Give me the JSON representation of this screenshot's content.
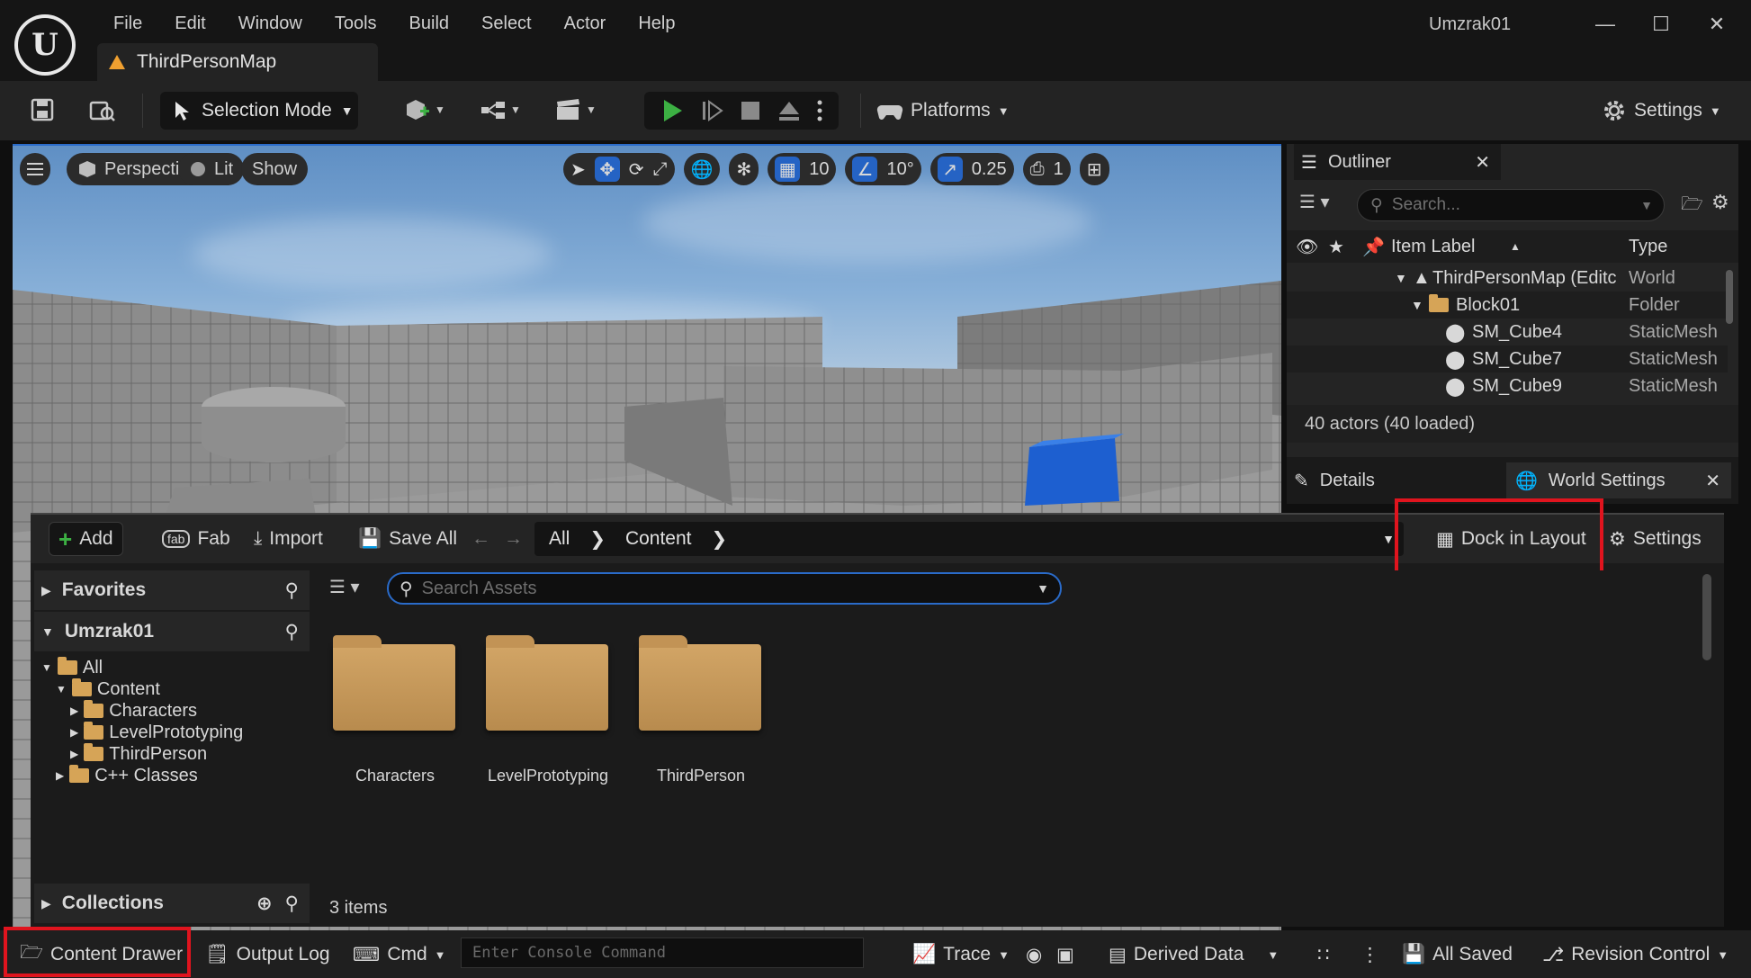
{
  "app": {
    "project_name": "Umzrak01",
    "menu": [
      "File",
      "Edit",
      "Window",
      "Tools",
      "Build",
      "Select",
      "Actor",
      "Help"
    ],
    "map_tab": "ThirdPersonMap"
  },
  "toolbar": {
    "selection_mode": "Selection Mode",
    "platforms": "Platforms",
    "settings": "Settings"
  },
  "viewport": {
    "perspective": "Perspective",
    "lit": "Lit",
    "show": "Show",
    "grid_snap": "10",
    "rotation_snap": "10°",
    "scale_snap": "0.25",
    "camera_speed": "1"
  },
  "outliner": {
    "tab": "Outliner",
    "search_placeholder": "Search...",
    "col_label": "Item Label",
    "col_type": "Type",
    "rows": [
      {
        "label": "ThirdPersonMap (Editc",
        "type": "World"
      },
      {
        "label": "Block01",
        "type": "Folder"
      },
      {
        "label": "SM_Cube4",
        "type": "StaticMesh"
      },
      {
        "label": "SM_Cube7",
        "type": "StaticMesh"
      },
      {
        "label": "SM_Cube9",
        "type": "StaticMesh"
      }
    ],
    "footer": "40 actors (40 loaded)"
  },
  "details": {
    "tab": "Details",
    "world_settings": "World Settings"
  },
  "drawer": {
    "add": "Add",
    "fab": "Fab",
    "import": "Import",
    "save_all": "Save All",
    "path": [
      "All",
      "Content"
    ],
    "dock_in_layout": "Dock in Layout",
    "settings": "Settings",
    "favorites": "Favorites",
    "project": "Umzrak01",
    "tree": [
      {
        "label": "All"
      },
      {
        "label": "Content"
      },
      {
        "label": "Characters"
      },
      {
        "label": "LevelPrototyping"
      },
      {
        "label": "ThirdPerson"
      },
      {
        "label": "C++ Classes"
      }
    ],
    "collections": "Collections",
    "search_placeholder": "Search Assets",
    "assets": [
      "Characters",
      "LevelPrototyping",
      "ThirdPerson"
    ],
    "item_count": "3 items"
  },
  "statusbar": {
    "content_drawer": "Content Drawer",
    "output_log": "Output Log",
    "cmd": "Cmd",
    "console_placeholder": "Enter Console Command",
    "trace": "Trace",
    "derived_data": "Derived Data",
    "all_saved": "All Saved",
    "revision_control": "Revision Control"
  },
  "colors": {
    "highlight": "#e0141e",
    "accent": "#2563c4",
    "play": "#3cb043",
    "folder": "#d2a566"
  }
}
